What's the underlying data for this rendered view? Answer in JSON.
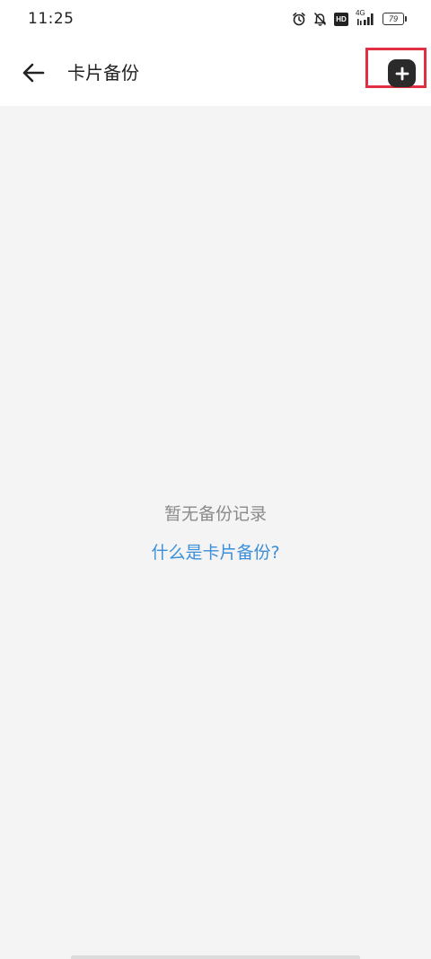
{
  "status_bar": {
    "time": "11:25",
    "network": "4G",
    "hd_label": "HD",
    "battery": "79",
    "icons": [
      "alarm-icon",
      "bell-off-icon",
      "hd-icon",
      "signal-icon",
      "battery-icon"
    ]
  },
  "app_bar": {
    "title": "卡片备份",
    "back_icon": "arrow-left-icon",
    "add_icon": "plus-icon",
    "highlight_color": "#e03042"
  },
  "main": {
    "empty_message": "暂无备份记录",
    "help_link": "什么是卡片备份?",
    "link_color": "#3b8ed8"
  }
}
